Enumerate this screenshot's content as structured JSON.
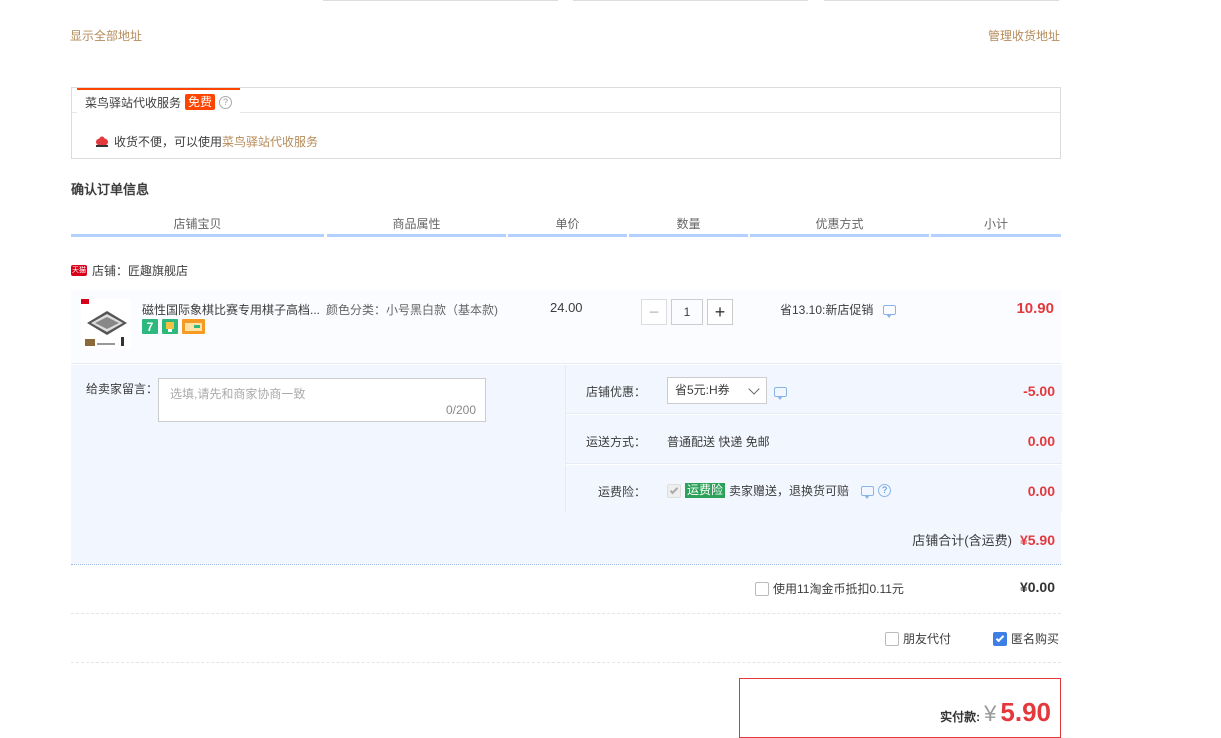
{
  "address": {
    "show_all": "显示全部地址",
    "manage": "管理收货地址"
  },
  "cainiao": {
    "tab_label": "菜鸟驿站代收服务",
    "free_badge": "免费",
    "help_icon": "?",
    "notice_prefix": "收货不便，可以使用",
    "notice_link": "菜鸟驿站代收服务"
  },
  "order": {
    "section_title": "确认订单信息",
    "columns": [
      "店铺宝贝",
      "商品属性",
      "单价",
      "数量",
      "优惠方式",
      "小计"
    ]
  },
  "shop": {
    "badge": "天猫",
    "label": "店铺：匠趣旗舰店"
  },
  "item": {
    "title": "磁性国际象棋比赛专用棋子高档...",
    "attribute": "颜色分类：小号黑白款（基本款)",
    "unit_price": "24.00",
    "quantity": "1",
    "minus": "−",
    "plus": "+",
    "promo": "省13.10:新店促销",
    "subtotal": "10.90",
    "service_icons": [
      "7-day-return-icon",
      "service-badge-icon",
      "card-payment-icon"
    ]
  },
  "message": {
    "label": "给卖家留言：",
    "placeholder": "选填,请先和商家协商一致",
    "counter": "0/200"
  },
  "store_discount": {
    "label": "店铺优惠：",
    "selected": "省5元:H券",
    "amount": "-5.00"
  },
  "shipping": {
    "label": "运送方式：",
    "method": "普通配送 快递 免邮",
    "amount": "0.00"
  },
  "insurance": {
    "label": "运费险：",
    "badge": "运费险",
    "text": "卖家赠送，退换货可赔",
    "amount": "0.00"
  },
  "shop_total": {
    "label": "店铺合计(含运费)",
    "amount": "¥5.90"
  },
  "coins": {
    "label": "使用11淘金币抵扣0.11元",
    "amount": "¥0.00"
  },
  "options": {
    "friend_pay": "朋友代付",
    "anonymous": "匿名购买"
  },
  "payment": {
    "label": "实付款:",
    "currency": "¥",
    "amount": "5.90"
  },
  "colors": {
    "accent_red": "#e4393c",
    "link_brown": "#b58b5a",
    "header_blue": "#b2d1ff",
    "panel_blue": "#f2f7ff"
  }
}
